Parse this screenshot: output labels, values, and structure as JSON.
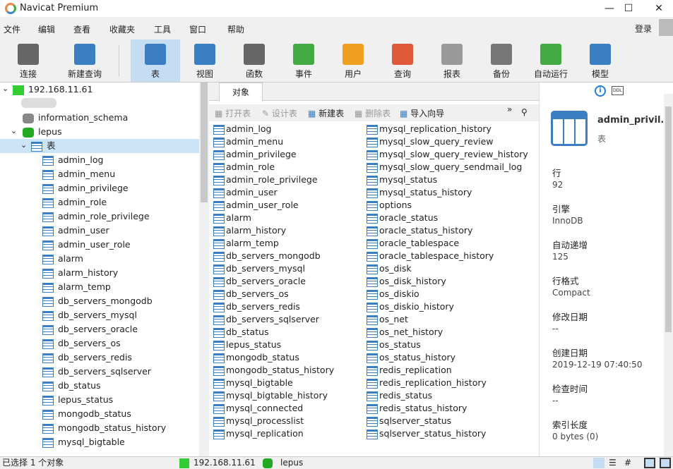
{
  "app_title": "Navicat Premium",
  "window_controls": {
    "minimize": "—",
    "maximize": "☐",
    "close": "✕"
  },
  "menu": [
    "文件",
    "编辑",
    "查看",
    "收藏夹",
    "工具",
    "窗口",
    "帮助"
  ],
  "login": "登录",
  "toolbar": [
    {
      "label": "连接",
      "icon": "plug-icon",
      "color": "#666"
    },
    {
      "label": "新建查询",
      "icon": "new-query-icon",
      "color": "#3a7fc1"
    },
    {
      "label": "表",
      "icon": "table-icon",
      "color": "#3a7fc1"
    },
    {
      "label": "视图",
      "icon": "view-icon",
      "color": "#3a7fc1"
    },
    {
      "label": "函数",
      "icon": "function-icon",
      "color": "#666"
    },
    {
      "label": "事件",
      "icon": "clock-icon",
      "color": "#4a4"
    },
    {
      "label": "用户",
      "icon": "user-icon",
      "color": "#f0a020"
    },
    {
      "label": "查询",
      "icon": "query-icon",
      "color": "#e05a3a"
    },
    {
      "label": "报表",
      "icon": "report-icon",
      "color": "#999"
    },
    {
      "label": "备份",
      "icon": "backup-icon",
      "color": "#777"
    },
    {
      "label": "自动运行",
      "icon": "schedule-icon",
      "color": "#4a4"
    },
    {
      "label": "模型",
      "icon": "model-icon",
      "color": "#3a7fc1"
    }
  ],
  "tree": {
    "connection": "192.168.11.61",
    "databases": [
      "information_schema",
      "lepus"
    ],
    "tables_node": "表",
    "tables": [
      "admin_log",
      "admin_menu",
      "admin_privilege",
      "admin_role",
      "admin_role_privilege",
      "admin_user",
      "admin_user_role",
      "alarm",
      "alarm_history",
      "alarm_temp",
      "db_servers_mongodb",
      "db_servers_mysql",
      "db_servers_oracle",
      "db_servers_os",
      "db_servers_redis",
      "db_servers_sqlserver",
      "db_status",
      "lepus_status",
      "mongodb_status",
      "mongodb_status_history",
      "mysql_bigtable"
    ]
  },
  "tab": "对象",
  "object_toolbar": {
    "open": "打开表",
    "design": "设计表",
    "new": "新建表",
    "delete": "删除表",
    "import": "导入向导",
    "more": "»"
  },
  "objects_col1": [
    "admin_log",
    "admin_menu",
    "admin_privilege",
    "admin_role",
    "admin_role_privilege",
    "admin_user",
    "admin_user_role",
    "alarm",
    "alarm_history",
    "alarm_temp",
    "db_servers_mongodb",
    "db_servers_mysql",
    "db_servers_oracle",
    "db_servers_os",
    "db_servers_redis",
    "db_servers_sqlserver",
    "db_status",
    "lepus_status",
    "mongodb_status",
    "mongodb_status_history",
    "mysql_bigtable",
    "mysql_bigtable_history",
    "mysql_connected",
    "mysql_processlist",
    "mysql_replication"
  ],
  "objects_col2": [
    "mysql_replication_history",
    "mysql_slow_query_review",
    "mysql_slow_query_review_history",
    "mysql_slow_query_sendmail_log",
    "mysql_status",
    "mysql_status_history",
    "options",
    "oracle_status",
    "oracle_status_history",
    "oracle_tablespace",
    "oracle_tablespace_history",
    "os_disk",
    "os_disk_history",
    "os_diskio",
    "os_diskio_history",
    "os_net",
    "os_net_history",
    "os_status",
    "os_status_history",
    "redis_replication",
    "redis_replication_history",
    "redis_status",
    "redis_status_history",
    "sqlserver_status",
    "sqlserver_status_history"
  ],
  "info": {
    "name": "admin_privil...",
    "type": "表",
    "ddl": "DDL",
    "props": [
      {
        "label": "行",
        "value": "92"
      },
      {
        "label": "引擎",
        "value": "InnoDB"
      },
      {
        "label": "自动递增",
        "value": "125"
      },
      {
        "label": "行格式",
        "value": "Compact"
      },
      {
        "label": "修改日期",
        "value": "--"
      },
      {
        "label": "创建日期",
        "value": "2019-12-19 07:40:50"
      },
      {
        "label": "检查时间",
        "value": "--"
      },
      {
        "label": "索引长度",
        "value": "0 bytes (0)"
      }
    ]
  },
  "status": {
    "selection": "已选择 1 个对象",
    "connection": "192.168.11.61",
    "database": "lepus"
  }
}
